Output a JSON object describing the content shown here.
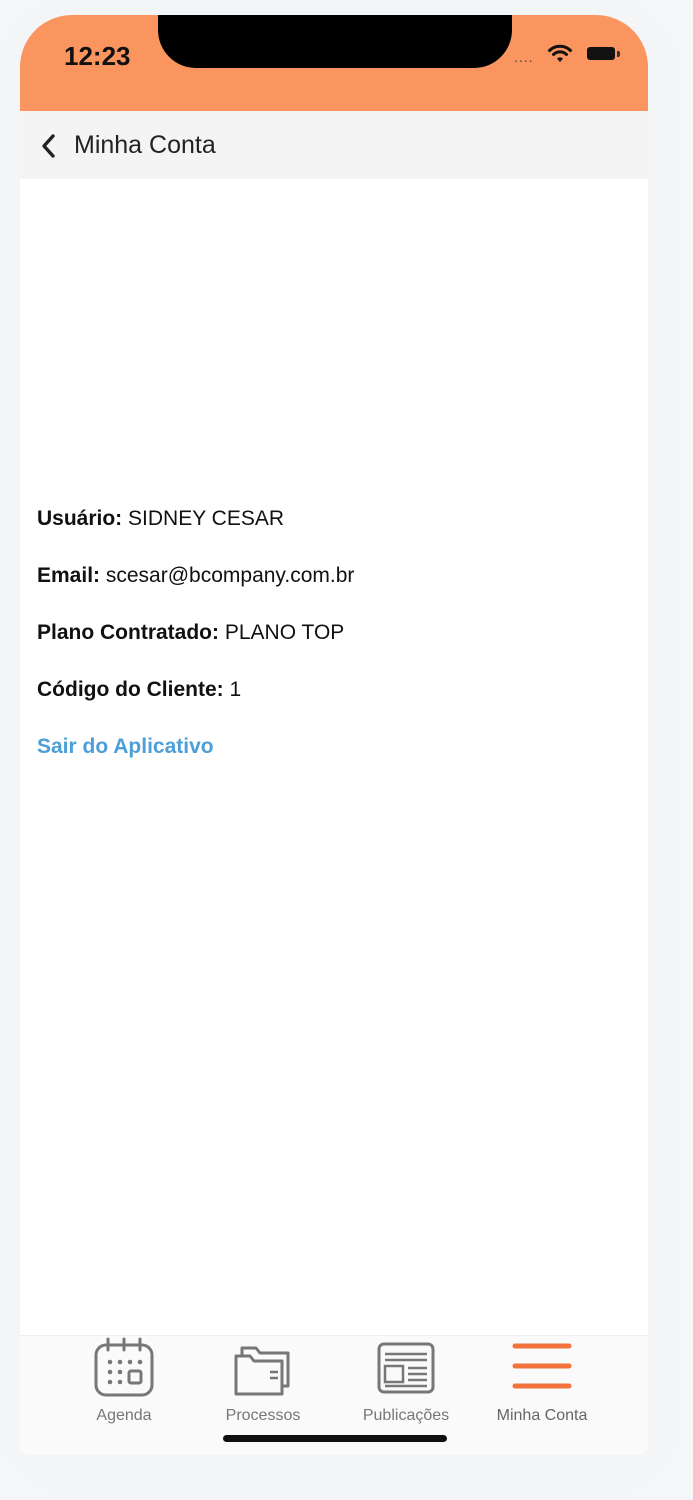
{
  "status_bar": {
    "time": "12:23",
    "signal_text": "....",
    "bg_color": "#fa955f"
  },
  "nav": {
    "title": "Minha Conta",
    "back_icon": "chevron-left-icon"
  },
  "account": {
    "user_label": "Usuário:",
    "user_value": "SIDNEY CESAR",
    "email_label": "Email:",
    "email_value": "scesar@bcompany.com.br",
    "plan_label": "Plano Contratado:",
    "plan_value": "PLANO TOP",
    "client_code_label": "Código do Cliente:",
    "client_code_value": "1",
    "logout_link": "Sair do Aplicativo",
    "link_color": "#4c9fd8"
  },
  "tabs": [
    {
      "label": "Agenda",
      "icon": "calendar-icon"
    },
    {
      "label": "Processos",
      "icon": "folder-icon"
    },
    {
      "label": "Publicações",
      "icon": "newspaper-icon"
    },
    {
      "label": "Minha Conta",
      "icon": "menu-icon",
      "active": true
    }
  ],
  "accent_color": "#f2733c"
}
